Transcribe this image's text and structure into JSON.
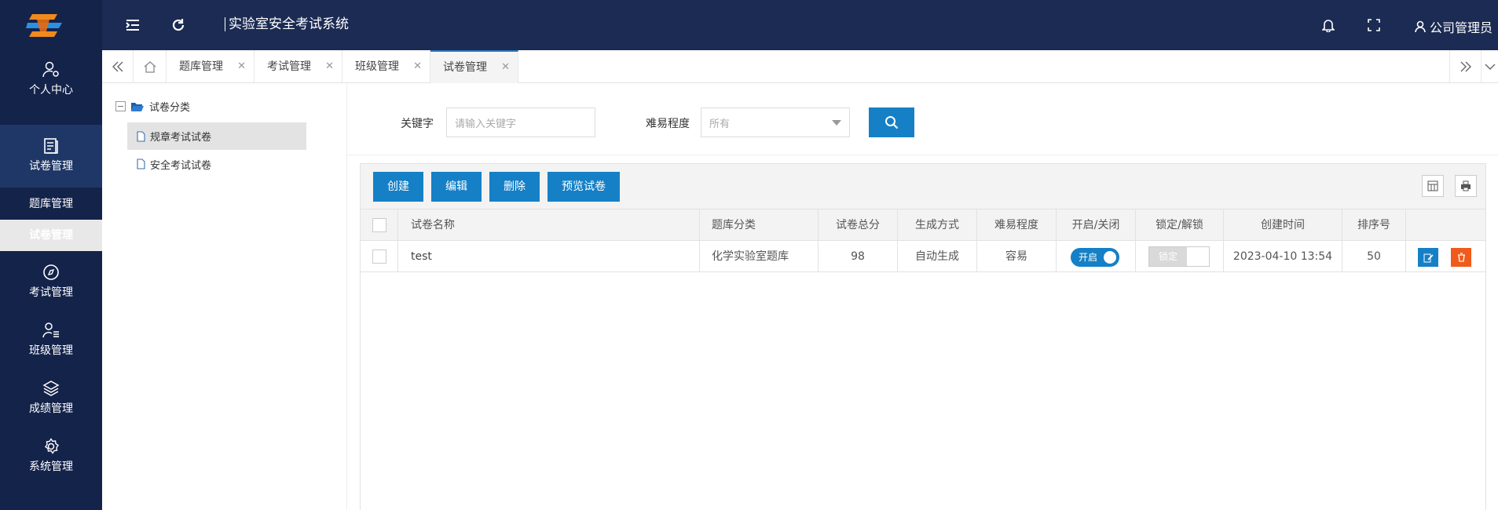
{
  "header": {
    "title": "实验室安全考试系统",
    "user": "公司管理员"
  },
  "sidebar": {
    "items": [
      {
        "label": "个人中心"
      },
      {
        "label": "试卷管理"
      },
      {
        "label": "考试管理"
      },
      {
        "label": "班级管理"
      },
      {
        "label": "成绩管理"
      },
      {
        "label": "系统管理"
      }
    ],
    "subitems": [
      {
        "label": "题库管理"
      },
      {
        "label": "试卷管理"
      }
    ]
  },
  "tabs": [
    {
      "label": "题库管理"
    },
    {
      "label": "考试管理"
    },
    {
      "label": "班级管理"
    },
    {
      "label": "试卷管理"
    }
  ],
  "tree": {
    "root": "试卷分类",
    "children": [
      {
        "label": "规章考试试卷"
      },
      {
        "label": "安全考试试卷"
      }
    ]
  },
  "search": {
    "keyword_label": "关键字",
    "keyword_placeholder": "请输入关键字",
    "difficulty_label": "难易程度",
    "difficulty_value": "所有"
  },
  "toolbar": {
    "create": "创建",
    "edit": "编辑",
    "delete": "删除",
    "preview": "预览试卷"
  },
  "table": {
    "columns": [
      "试卷名称",
      "题库分类",
      "试卷总分",
      "生成方式",
      "难易程度",
      "开启/关闭",
      "锁定/解锁",
      "创建时间",
      "排序号"
    ],
    "rows": [
      {
        "name": "test",
        "category": "化学实验室题库",
        "score": "98",
        "method": "自动生成",
        "difficulty": "容易",
        "open": "开启",
        "lock": "锁定",
        "created": "2023-04-10 13:54",
        "order": "50"
      }
    ]
  },
  "colors": {
    "header_bg": "#1c2b53",
    "sidebar_bg": "#14234a",
    "accent": "#1580c6",
    "delete": "#f05a1a"
  }
}
